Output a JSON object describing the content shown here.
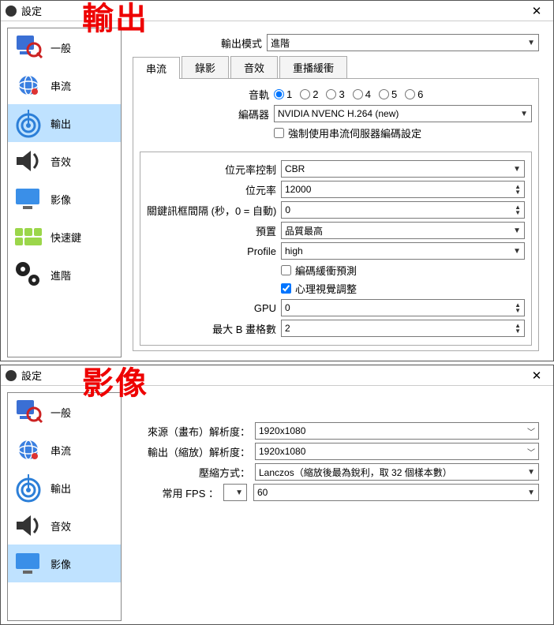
{
  "window1": {
    "title": "設定",
    "overlay": "輸出",
    "sidebar": [
      {
        "label": "一般",
        "icon": "general"
      },
      {
        "label": "串流",
        "icon": "stream"
      },
      {
        "label": "輸出",
        "icon": "output",
        "selected": true
      },
      {
        "label": "音效",
        "icon": "audio"
      },
      {
        "label": "影像",
        "icon": "video"
      },
      {
        "label": "快速鍵",
        "icon": "hotkeys"
      },
      {
        "label": "進階",
        "icon": "advanced"
      }
    ],
    "output_mode_label": "輸出模式",
    "output_mode_value": "進階",
    "tabs": [
      "串流",
      "錄影",
      "音效",
      "重播緩衝"
    ],
    "active_tab": "串流",
    "track_label": "音軌",
    "tracks": [
      "1",
      "2",
      "3",
      "4",
      "5",
      "6"
    ],
    "encoder_label": "編碼器",
    "encoder_value": "NVIDIA NVENC H.264 (new)",
    "enforce_label": "強制使用串流伺服器編碼設定",
    "rate_control_label": "位元率控制",
    "rate_control_value": "CBR",
    "bitrate_label": "位元率",
    "bitrate_value": "12000",
    "keyint_label": "關鍵訊框間隔 (秒，0 = 自動)",
    "keyint_value": "0",
    "preset_label": "預置",
    "preset_value": "品質最高",
    "profile_label": "Profile",
    "profile_value": "high",
    "lookahead_label": "編碼緩衝預測",
    "psycho_label": "心理視覺調整",
    "gpu_label": "GPU",
    "gpu_value": "0",
    "bframes_label": "最大 B 畫格數",
    "bframes_value": "2"
  },
  "window2": {
    "title": "設定",
    "overlay": "影像",
    "sidebar": [
      {
        "label": "一般",
        "icon": "general"
      },
      {
        "label": "串流",
        "icon": "stream"
      },
      {
        "label": "輸出",
        "icon": "output"
      },
      {
        "label": "音效",
        "icon": "audio"
      },
      {
        "label": "影像",
        "icon": "video",
        "selected": true
      }
    ],
    "base_label": "來源（畫布）解析度：",
    "base_value": "1920x1080",
    "scaled_label": "輸出（縮放）解析度：",
    "scaled_value": "1920x1080",
    "filter_label": "壓縮方式：",
    "filter_value": "Lanczos（縮放後最為銳利，取 32 個樣本數）",
    "fps_label": "常用 FPS ：",
    "fps_value": "60"
  }
}
